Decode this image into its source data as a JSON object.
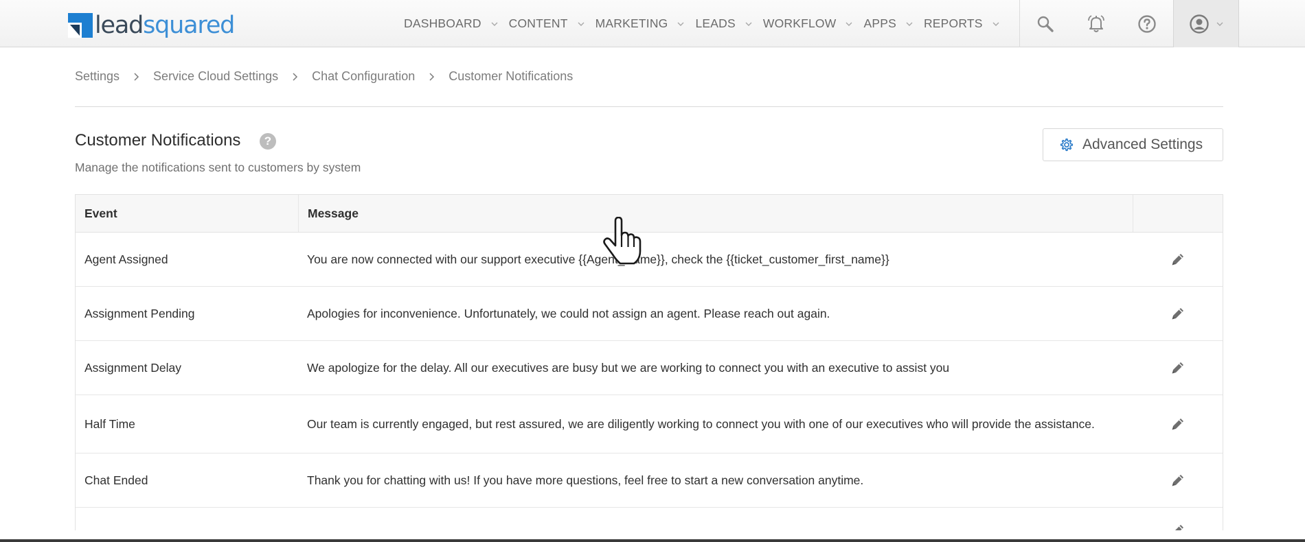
{
  "header": {
    "logo": {
      "text_lead": "lead",
      "text_squared": "squared",
      "icon": "leadsquared-logo-icon"
    },
    "nav": [
      {
        "label": "DASHBOARD"
      },
      {
        "label": "CONTENT"
      },
      {
        "label": "MARKETING"
      },
      {
        "label": "LEADS"
      },
      {
        "label": "WORKFLOW"
      },
      {
        "label": "APPS"
      },
      {
        "label": "REPORTS"
      }
    ],
    "icons": [
      "search-icon",
      "notification-bell-icon",
      "help-icon",
      "user-avatar-icon"
    ]
  },
  "breadcrumb": [
    {
      "label": "Settings"
    },
    {
      "label": "Service Cloud Settings"
    },
    {
      "label": "Chat Configuration"
    },
    {
      "label": "Customer Notifications"
    }
  ],
  "page": {
    "title": "Customer Notifications",
    "help": "?",
    "subtitle": "Manage the notifications sent to customers by system",
    "advanced_settings_label": "Advanced Settings"
  },
  "table": {
    "headers": {
      "event": "Event",
      "message": "Message",
      "actions": ""
    },
    "rows": [
      {
        "event": "Agent Assigned",
        "message": "You are now connected with our support executive {{Agent_Name}}, check the {{ticket_customer_first_name}}"
      },
      {
        "event": "Assignment Pending",
        "message": "Apologies for inconvenience. Unfortunately, we could not assign an agent. Please reach out again."
      },
      {
        "event": "Assignment Delay",
        "message": "We apologize for the delay. All our executives are busy but we are working to connect you with an executive to assist you"
      },
      {
        "event": "Half Time",
        "message": "Our team is currently engaged, but rest assured, we are diligently working to connect you with one of our executives who will provide the assistance."
      },
      {
        "event": "Chat Ended",
        "message": "Thank you for chatting with us! If you have more questions, feel free to start a new conversation anytime."
      },
      {
        "event": "",
        "message": ""
      }
    ]
  },
  "colors": {
    "brand_blue": "#3d8fd6",
    "brand_dark": "#3a4a5a",
    "nav_text": "#6b6b6b"
  }
}
